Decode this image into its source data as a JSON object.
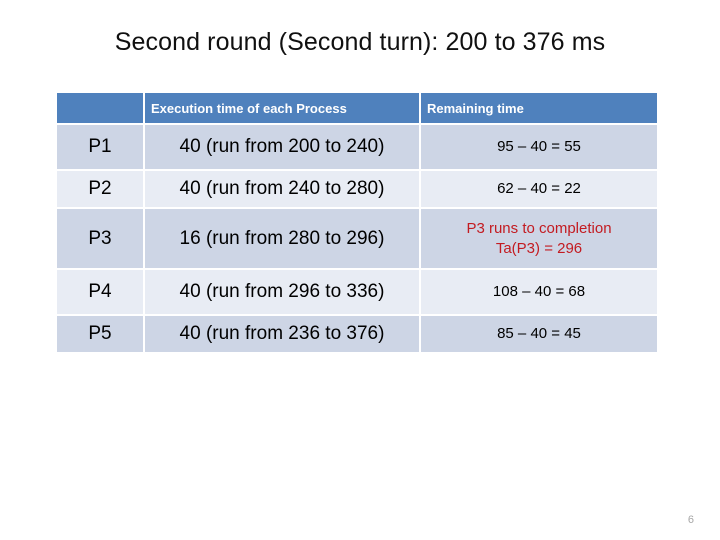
{
  "slide": {
    "title": "Second round (Second turn): 200 to 376 ms",
    "page_number": "6"
  },
  "table": {
    "headers": {
      "col1": "",
      "col2": "Execution time of each Process",
      "col3": "Remaining time"
    },
    "rows": [
      {
        "process": "P1",
        "execution": "40 (run from 200 to 240)",
        "remaining_line1": "95 – 40  = 55",
        "remaining_line2": "",
        "highlight": "false"
      },
      {
        "process": "P2",
        "execution": "40 (run from 240 to 280)",
        "remaining_line1": "62 – 40 = 22",
        "remaining_line2": "",
        "highlight": "false"
      },
      {
        "process": "P3",
        "execution": "16 (run from 280 to 296)",
        "remaining_line1": "P3 runs to completion",
        "remaining_line2": "Ta(P3) = 296",
        "highlight": "true"
      },
      {
        "process": "P4",
        "execution": "40 (run from 296 to 336)",
        "remaining_line1": "108 – 40 = 68",
        "remaining_line2": "",
        "highlight": "false"
      },
      {
        "process": "P5",
        "execution": "40 (run from 236 to 376)",
        "remaining_line1": "85 – 40 = 45",
        "remaining_line2": "",
        "highlight": "false"
      }
    ]
  },
  "colors": {
    "header_blue": "#4f81bd",
    "band_dark": "#cdd5e5",
    "band_light": "#e8ecf4",
    "highlight_red": "#c31b21",
    "page_number_gray": "#a6a6a6"
  }
}
